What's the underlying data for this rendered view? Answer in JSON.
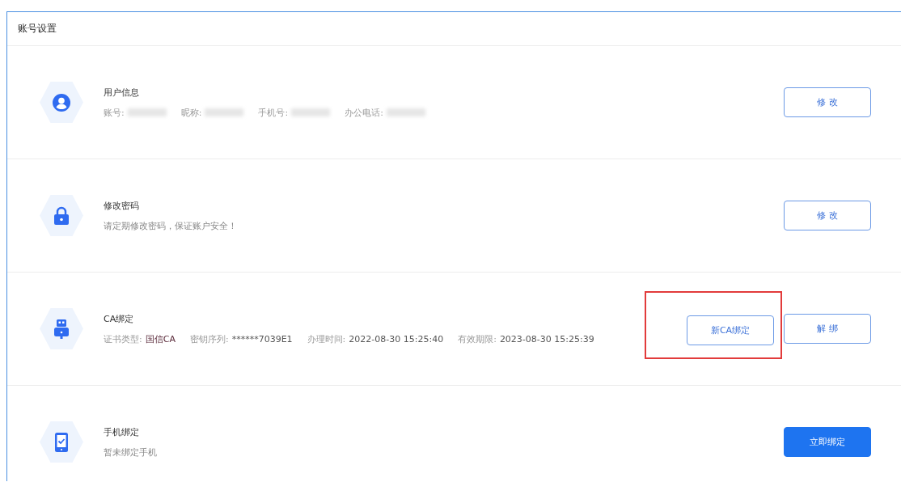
{
  "page": {
    "title": "账号设置"
  },
  "sections": [
    {
      "title": "用户信息",
      "fields": [
        {
          "label": "账号:",
          "redacted": true
        },
        {
          "label": "昵称:",
          "redacted": true
        },
        {
          "label": "手机号:",
          "redacted": true
        },
        {
          "label": "办公电话:",
          "redacted": true
        }
      ],
      "buttons": [
        {
          "label": "修 改",
          "kind": "outline",
          "highlighted": false
        }
      ]
    },
    {
      "title": "修改密码",
      "description": "请定期修改密码，保证账户安全！",
      "buttons": [
        {
          "label": "修 改",
          "kind": "outline",
          "highlighted": false
        }
      ]
    },
    {
      "title": "CA绑定",
      "fields": [
        {
          "label": "证书类型:",
          "value": "国信CA",
          "redacted": false,
          "emphasis": true
        },
        {
          "label": "密钥序列:",
          "value": "******7039E1",
          "redacted": false,
          "emphasis": false
        },
        {
          "label": "办理时间:",
          "value": "2022-08-30 15:25:40",
          "redacted": false,
          "emphasis": false
        },
        {
          "label": "有效期限:",
          "value": "2023-08-30 15:25:39",
          "redacted": false,
          "emphasis": false
        }
      ],
      "buttons": [
        {
          "label": "新CA绑定",
          "kind": "outline",
          "highlighted": true
        },
        {
          "label": "解 绑",
          "kind": "outline",
          "highlighted": false
        }
      ]
    },
    {
      "title": "手机绑定",
      "description": "暂未绑定手机",
      "buttons": [
        {
          "label": "立即绑定",
          "kind": "primary",
          "highlighted": false
        }
      ]
    }
  ]
}
